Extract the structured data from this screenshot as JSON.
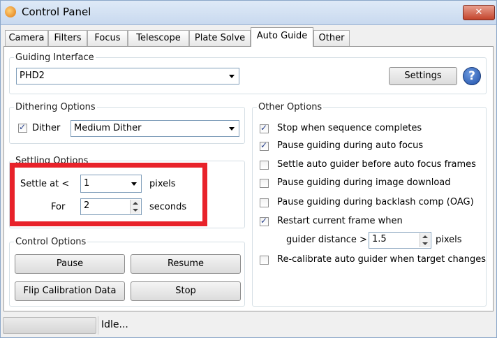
{
  "window": {
    "title": "Control Panel",
    "close_symbol": "✕"
  },
  "tabs": [
    {
      "label": "Camera"
    },
    {
      "label": "Filters"
    },
    {
      "label": "Focus"
    },
    {
      "label": "Telescope"
    },
    {
      "label": "Plate Solve"
    },
    {
      "label": "Auto Guide"
    },
    {
      "label": "Other"
    }
  ],
  "active_tab": "Auto Guide",
  "guiding_interface": {
    "legend": "Guiding Interface",
    "selected": "PHD2",
    "settings_label": "Settings",
    "help_symbol": "?"
  },
  "dithering": {
    "legend": "Dithering Options",
    "dither_label": "Dither",
    "dither_checked": true,
    "selected": "Medium Dither"
  },
  "settling": {
    "legend": "Settling Options",
    "settle_label": "Settle at <",
    "settle_value": "1",
    "settle_unit": "pixels",
    "for_label": "For",
    "for_value": "2",
    "for_unit": "seconds",
    "highlight_color": "#e8222a"
  },
  "control": {
    "legend": "Control Options",
    "pause": "Pause",
    "resume": "Resume",
    "flip": "Flip Calibration Data",
    "stop": "Stop"
  },
  "other": {
    "legend": "Other Options",
    "items": [
      {
        "label": "Stop when sequence completes",
        "checked": true
      },
      {
        "label": "Pause guiding during auto focus",
        "checked": true
      },
      {
        "label": "Settle auto guider before auto focus frames",
        "checked": false
      },
      {
        "label": "Pause guiding during image download",
        "checked": false
      },
      {
        "label": "Pause guiding during backlash comp (OAG)",
        "checked": false
      },
      {
        "label": "Restart current frame when",
        "checked": true
      },
      {
        "label": "Re-calibrate auto guider when target changes",
        "checked": false
      }
    ],
    "guider_distance_label": "guider distance >",
    "guider_distance_value": "1.5",
    "guider_distance_unit": "pixels"
  },
  "status": {
    "text": "Idle..."
  }
}
